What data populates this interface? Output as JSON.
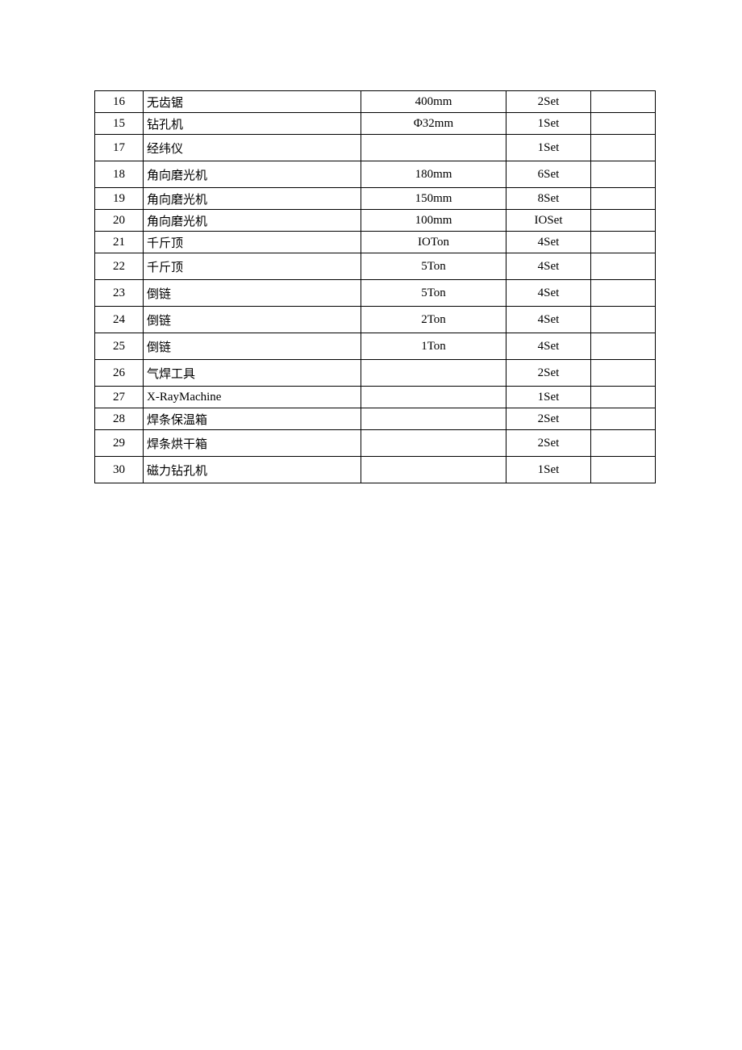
{
  "table": {
    "rows": [
      {
        "num": "16",
        "name": "无齿锯",
        "spec": "400mm",
        "qty": "2Set",
        "rem": "",
        "tall": false
      },
      {
        "num": "15",
        "name": "钻孔机",
        "spec": "Φ32mm",
        "qty": "1Set",
        "rem": "",
        "tall": false
      },
      {
        "num": "17",
        "name": "经纬仪",
        "spec": "",
        "qty": "1Set",
        "rem": "",
        "tall": true
      },
      {
        "num": "18",
        "name": "角向磨光机",
        "spec": "180mm",
        "qty": "6Set",
        "rem": "",
        "tall": true
      },
      {
        "num": "19",
        "name": "角向磨光机",
        "spec": "150mm",
        "qty": "8Set",
        "rem": "",
        "tall": false
      },
      {
        "num": "20",
        "name": "角向磨光机",
        "spec": "100mm",
        "qty": "IOSet",
        "rem": "",
        "tall": false
      },
      {
        "num": "21",
        "name": "千斤顶",
        "spec": "IOTon",
        "qty": "4Set",
        "rem": "",
        "tall": false
      },
      {
        "num": "22",
        "name": "千斤顶",
        "spec": "5Ton",
        "qty": "4Set",
        "rem": "",
        "tall": true
      },
      {
        "num": "23",
        "name": "倒链",
        "spec": "5Ton",
        "qty": "4Set",
        "rem": "",
        "tall": true
      },
      {
        "num": "24",
        "name": "倒链",
        "spec": "2Ton",
        "qty": "4Set",
        "rem": "",
        "tall": true
      },
      {
        "num": "25",
        "name": "倒链",
        "spec": "1Ton",
        "qty": "4Set",
        "rem": "",
        "tall": true
      },
      {
        "num": "26",
        "name": "气焊工具",
        "spec": "",
        "qty": "2Set",
        "rem": "",
        "tall": true
      },
      {
        "num": "27",
        "name": "X-RayMachine",
        "spec": "",
        "qty": "1Set",
        "rem": "",
        "tall": false
      },
      {
        "num": "28",
        "name": "焊条保温箱",
        "spec": "",
        "qty": "2Set",
        "rem": "",
        "tall": false
      },
      {
        "num": "29",
        "name": "焊条烘干箱",
        "spec": "",
        "qty": "2Set",
        "rem": "",
        "tall": true
      },
      {
        "num": "30",
        "name": "磁力钻孔机",
        "spec": "",
        "qty": "1Set",
        "rem": "",
        "tall": true
      }
    ]
  }
}
